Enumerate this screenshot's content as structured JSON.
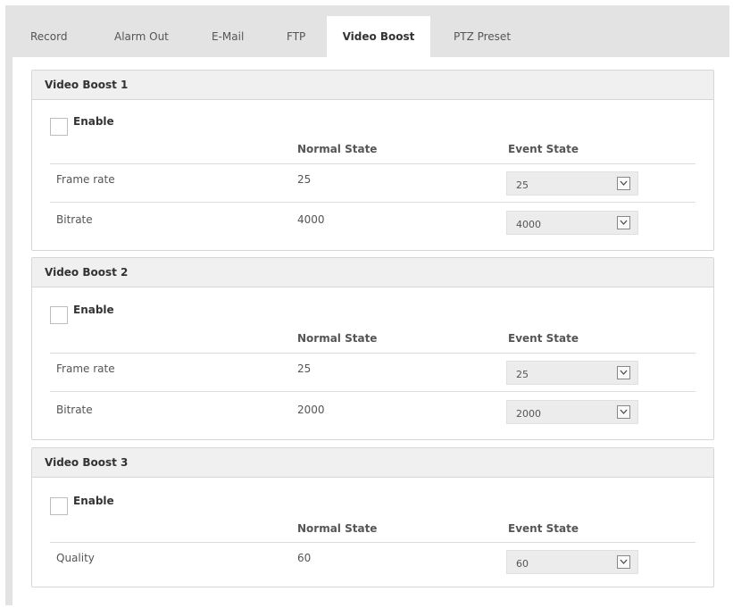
{
  "tabs": [
    {
      "label": "Record",
      "active": false
    },
    {
      "label": "Alarm Out",
      "active": false
    },
    {
      "label": "E-Mail",
      "active": false
    },
    {
      "label": "FTP",
      "active": false
    },
    {
      "label": "Video Boost",
      "active": true
    },
    {
      "label": "PTZ Preset",
      "active": false
    }
  ],
  "sections": [
    {
      "title": "Video Boost 1",
      "enable_label": "Enable",
      "enabled": false,
      "normal_state_header": "Normal State",
      "event_state_header": "Event State",
      "rows": [
        {
          "label": "Frame rate",
          "normal": "25",
          "event": "25"
        },
        {
          "label": "Bitrate",
          "normal": "4000",
          "event": "4000"
        }
      ]
    },
    {
      "title": "Video Boost 2",
      "enable_label": "Enable",
      "enabled": false,
      "normal_state_header": "Normal State",
      "event_state_header": "Event State",
      "rows": [
        {
          "label": "Frame rate",
          "normal": "25",
          "event": "25"
        },
        {
          "label": "Bitrate",
          "normal": "2000",
          "event": "2000"
        }
      ]
    },
    {
      "title": "Video Boost 3",
      "enable_label": "Enable",
      "enabled": false,
      "normal_state_header": "Normal State",
      "event_state_header": "Event State",
      "rows": [
        {
          "label": "Quality",
          "normal": "60",
          "event": "60"
        }
      ]
    }
  ],
  "icons": {
    "checkbox": "checkbox-unchecked-icon",
    "dropdown": "chevron-down-icon"
  },
  "colors": {
    "tab_bar_bg": "#e3e3e3",
    "section_header_bg": "#f0f0f0",
    "select_bg": "#ececec"
  }
}
